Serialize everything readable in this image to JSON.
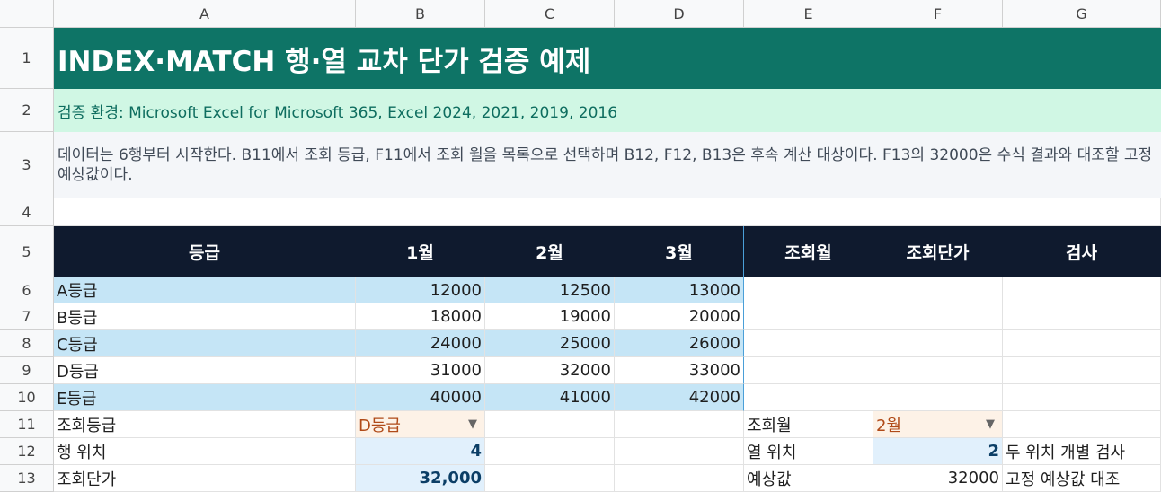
{
  "columns": [
    "A",
    "B",
    "C",
    "D",
    "E",
    "F",
    "G"
  ],
  "row_numbers": [
    "1",
    "2",
    "3",
    "4",
    "5",
    "6",
    "7",
    "8",
    "9",
    "10",
    "11",
    "12",
    "13"
  ],
  "title": "INDEX·MATCH 행·열 교차 단가 검증 예제",
  "environment": "검증 환경: Microsoft Excel for Microsoft 365, Excel 2024, 2021, 2019, 2016",
  "description": "데이터는 6행부터 시작한다. B11에서 조회 등급, F11에서 조회 월을 목록으로 선택하며 B12, F12, B13은 후속 계산 대상이다. F13의 32000은 수식 결과와 대조할 고정 예상값이다.",
  "headers": {
    "grade": "등급",
    "m1": "1월",
    "m2": "2월",
    "m3": "3월",
    "lookup_month": "조회월",
    "lookup_price": "조회단가",
    "check": "검사"
  },
  "table_rows": [
    {
      "grade": "A등급",
      "m1": "12000",
      "m2": "12500",
      "m3": "13000"
    },
    {
      "grade": "B등급",
      "m1": "18000",
      "m2": "19000",
      "m3": "20000"
    },
    {
      "grade": "C등급",
      "m1": "24000",
      "m2": "25000",
      "m3": "26000"
    },
    {
      "grade": "D등급",
      "m1": "31000",
      "m2": "32000",
      "m3": "33000"
    },
    {
      "grade": "E등급",
      "m1": "40000",
      "m2": "41000",
      "m3": "42000"
    }
  ],
  "lookup": {
    "grade_label": "조회등급",
    "grade_value": "D등급",
    "month_label": "조회월",
    "month_value": "2월",
    "row_pos_label": "행 위치",
    "row_pos_value": "4",
    "col_pos_label": "열 위치",
    "col_pos_value": "2",
    "col_pos_note": "두 위치 개별 검사",
    "price_label": "조회단가",
    "price_value": "32,000",
    "expected_label": "예상값",
    "expected_value": "32000",
    "expected_note": "고정 예상값 대조"
  },
  "colors": {
    "title_bg": "#0e7466",
    "env_bg": "#d0f7e4",
    "header_bg": "#0f1a2e",
    "band_blue": "#c5e5f6",
    "select_bg": "#fdf2e7",
    "calc_bg": "#e1f0fc"
  }
}
